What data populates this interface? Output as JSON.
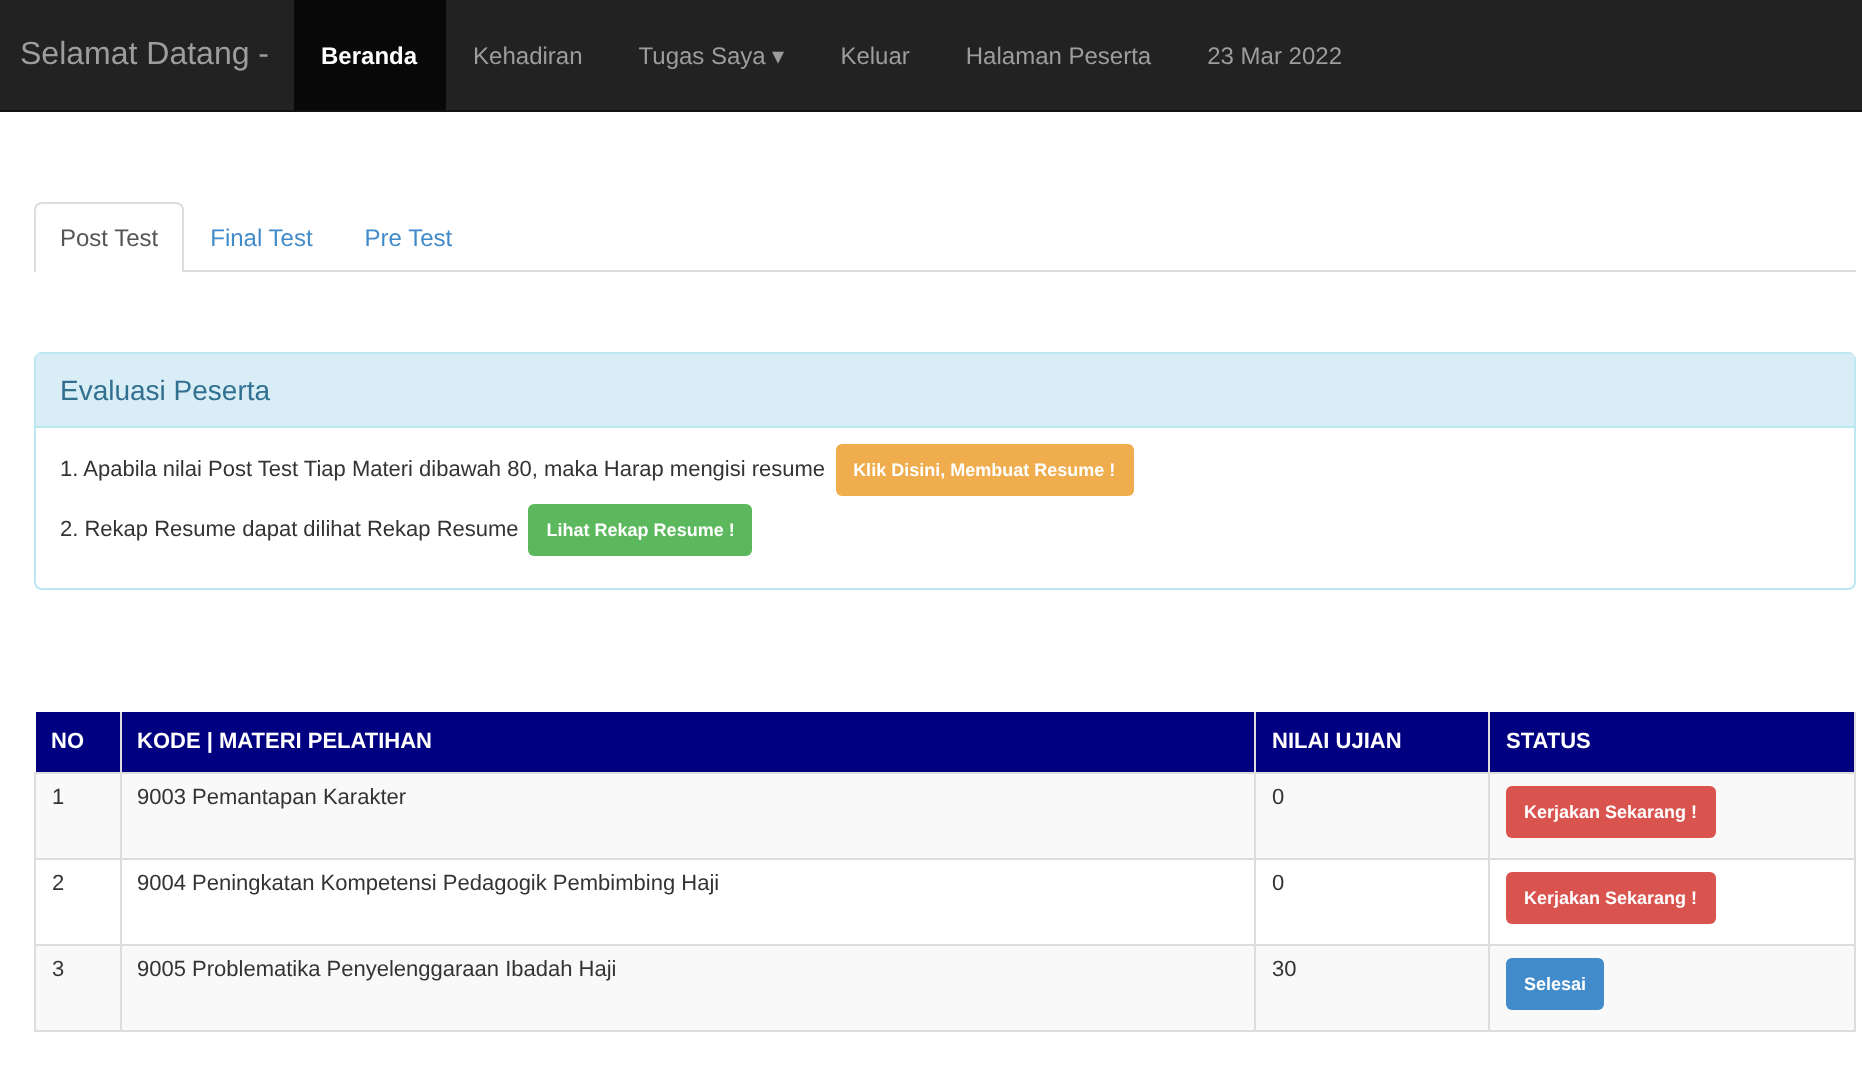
{
  "navbar": {
    "brand": "Selamat Datang -",
    "items": [
      {
        "label": "Beranda",
        "selected": true
      },
      {
        "label": "Kehadiran",
        "selected": false
      },
      {
        "label": "Tugas Saya ▾",
        "selected": false
      },
      {
        "label": "Keluar",
        "selected": false
      },
      {
        "label": "Halaman Peserta",
        "selected": false
      },
      {
        "label": "23 Mar 2022",
        "selected": false
      }
    ]
  },
  "tabs": [
    {
      "label": "Post Test",
      "selected": true
    },
    {
      "label": "Final Test",
      "selected": false
    },
    {
      "label": "Pre Test",
      "selected": false
    }
  ],
  "panel": {
    "title": "Evaluasi Peserta",
    "lines": [
      {
        "text": "1. Apabila nilai Post Test Tiap Materi dibawah 80, maka Harap mengisi resume",
        "button": "Klik Disini, Membuat Resume !",
        "kind": "warning"
      },
      {
        "text": "2. Rekap Resume dapat dilihat Rekap Resume",
        "button": "Lihat Rekap Resume !",
        "kind": "success"
      }
    ]
  },
  "table": {
    "columns": [
      "NO",
      "KODE | MATERI PELATIHAN",
      "NILAI UJIAN",
      "STATUS"
    ],
    "rows": [
      {
        "no": "1",
        "materi": "9003 Pemantapan Karakter",
        "nilai": "0",
        "status": "Kerjakan Sekarang !",
        "kind": "danger"
      },
      {
        "no": "2",
        "materi": "9004 Peningkatan Kompetensi Pedagogik Pembimbing Haji",
        "nilai": "0",
        "status": "Kerjakan Sekarang !",
        "kind": "danger"
      },
      {
        "no": "3",
        "materi": "9005 Problematika Penyelenggaraan Ibadah Haji",
        "nilai": "30",
        "status": "Selesai",
        "kind": "primary"
      }
    ]
  }
}
